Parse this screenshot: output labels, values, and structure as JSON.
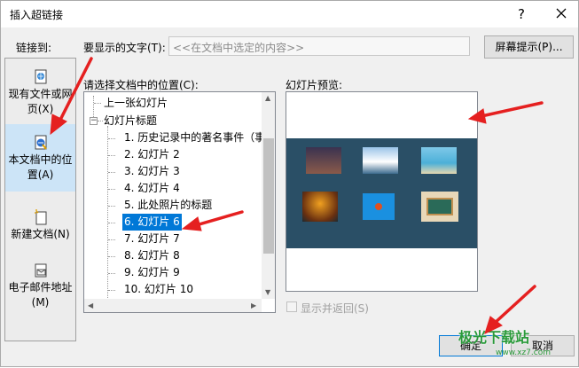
{
  "dialog": {
    "title": "插入超链接",
    "help": "?",
    "link_to_label": "链接到:",
    "display_text_label": "要显示的文字(T):",
    "display_text_placeholder": "<<在文档中选定的内容>>",
    "screentip_button": "屏幕提示(P)...",
    "ok_button": "确定",
    "cancel_button": "取消"
  },
  "sidebar": {
    "items": [
      {
        "label": "现有文件或网页(X)",
        "icon": "existing-file-icon"
      },
      {
        "label": "本文档中的位置(A)",
        "icon": "place-in-document-icon",
        "selected": true
      },
      {
        "label": "新建文档(N)",
        "icon": "new-document-icon"
      },
      {
        "label": "电子邮件地址(M)",
        "icon": "email-icon"
      }
    ]
  },
  "place": {
    "label": "请选择文档中的位置(C):",
    "items": [
      {
        "text": "上一张幻灯片"
      },
      {
        "text": "幻灯片标题"
      },
      {
        "text": "1. 历史记录中的著名事件（事"
      },
      {
        "text": "2. 幻灯片 2"
      },
      {
        "text": "3. 幻灯片 3"
      },
      {
        "text": "4. 幻灯片 4"
      },
      {
        "text": "5. 此处照片的标题"
      },
      {
        "text": "6. 幻灯片 6",
        "selected": true
      },
      {
        "text": "7. 幻灯片 7"
      },
      {
        "text": "8. 幻灯片 8"
      },
      {
        "text": "9. 幻灯片 9"
      },
      {
        "text": "10. 幻灯片 10"
      }
    ]
  },
  "preview": {
    "label": "幻灯片预览:",
    "show_and_return": "显示并返回(S)"
  },
  "watermark": {
    "text": "极光下载站",
    "url": "www.xz7.com"
  },
  "colors": {
    "selection": "#0078d7",
    "annotation_arrow": "#e52020",
    "slide_background": "#2a4f66"
  }
}
